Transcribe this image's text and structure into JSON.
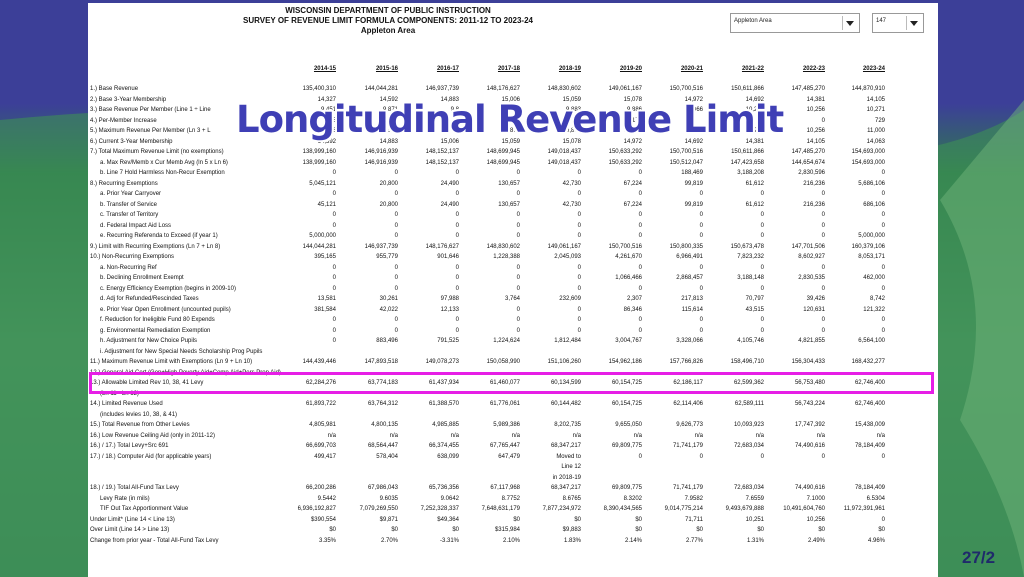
{
  "header": {
    "line1": "WISCONSIN DEPARTMENT OF PUBLIC INSTRUCTION",
    "line2": "SURVEY OF REVENUE LIMIT FORMULA COMPONENTS: 2011-12 TO 2023-24",
    "line3": "Appleton Area"
  },
  "controls": {
    "district_select": "Appleton Area",
    "code_select": "147"
  },
  "columns": [
    "2014-15",
    "2015-16",
    "2016-17",
    "2017-18",
    "2018-19",
    "2019-20",
    "2020-21",
    "2021-22",
    "2022-23",
    "2023-24"
  ],
  "rows": [
    {
      "label": "1.) Base Revenue",
      "values": [
        "135,400,310",
        "144,044,281",
        "146,937,739",
        "148,176,627",
        "148,830,602",
        "149,061,167",
        "150,700,516",
        "150,611,866",
        "147,485,270",
        "144,870,910"
      ]
    },
    {
      "label": "2.) Base 3-Year Membership",
      "values": [
        "14,327",
        "14,592",
        "14,883",
        "15,006",
        "15,059",
        "15,078",
        "14,972",
        "14,692",
        "14,381",
        "14,105"
      ]
    },
    {
      "label": "3.) Base Revenue Per Member (Line 1 ÷ Line",
      "values": [
        "9,451",
        "9,871",
        "9,8",
        "9,874",
        "9,883",
        "9,886",
        "10,066",
        "10,251",
        "10,256",
        "10,271"
      ]
    },
    {
      "label": "4.) Per-Member Increase",
      "values": [
        "75",
        "75",
        "",
        "",
        "",
        "175",
        "",
        "0",
        "0",
        "729"
      ]
    },
    {
      "label": "5.) Maximum Revenue Per Member (Ln 3 + L",
      "values": [
        "9,526",
        "9,946",
        "9,8",
        "9,874",
        "9,883",
        "10,061",
        "10,066",
        "10,251",
        "10,256",
        "11,000"
      ]
    },
    {
      "label": "6.) Current 3-Year Membership",
      "values": [
        "14,592",
        "14,883",
        "15,006",
        "15,059",
        "15,078",
        "14,972",
        "14,692",
        "14,381",
        "14,105",
        "14,063"
      ]
    },
    {
      "label": "7.) Total Maximum Revenue Limit (no exemptions)",
      "values": [
        "138,999,160",
        "146,916,939",
        "148,152,137",
        "148,699,945",
        "149,018,437",
        "150,633,292",
        "150,700,516",
        "150,611,866",
        "147,485,270",
        "154,693,000"
      ]
    },
    {
      "label": "a. Max Rev/Memb x Cur Memb Avg (ln 5 x Ln 6)",
      "ind": true,
      "values": [
        "138,999,160",
        "146,916,939",
        "148,152,137",
        "148,699,945",
        "149,018,437",
        "150,633,292",
        "150,512,047",
        "147,423,658",
        "144,654,674",
        "154,693,000"
      ]
    },
    {
      "label": "b. Line 7 Hold Harmless Non-Recur Exemption",
      "ind": true,
      "values": [
        "0",
        "0",
        "0",
        "0",
        "0",
        "0",
        "188,469",
        "3,188,208",
        "2,830,596",
        "0"
      ]
    },
    {
      "label": "8.) Recurring Exemptions",
      "values": [
        "5,045,121",
        "20,800",
        "24,490",
        "130,657",
        "42,730",
        "67,224",
        "99,819",
        "61,612",
        "216,236",
        "5,686,106"
      ]
    },
    {
      "label": "a. Prior Year Carryover",
      "ind": true,
      "values": [
        "0",
        "0",
        "0",
        "0",
        "0",
        "0",
        "0",
        "0",
        "0",
        "0"
      ]
    },
    {
      "label": "b. Transfer of Service",
      "ind": true,
      "values": [
        "45,121",
        "20,800",
        "24,490",
        "130,657",
        "42,730",
        "67,224",
        "99,819",
        "61,612",
        "216,236",
        "686,106"
      ]
    },
    {
      "label": "c. Transfer of Territory",
      "ind": true,
      "values": [
        "0",
        "0",
        "0",
        "0",
        "0",
        "0",
        "0",
        "0",
        "0",
        "0"
      ]
    },
    {
      "label": "d. Federal Impact Aid Loss",
      "ind": true,
      "values": [
        "0",
        "0",
        "0",
        "0",
        "0",
        "0",
        "0",
        "0",
        "0",
        "0"
      ]
    },
    {
      "label": "e. Recurring Referenda to Exceed (if year 1)",
      "ind": true,
      "values": [
        "5,000,000",
        "0",
        "0",
        "0",
        "0",
        "0",
        "0",
        "0",
        "0",
        "5,000,000"
      ]
    },
    {
      "label": "9.) Limit with Recurring Exemptions (Ln 7 + Ln 8)",
      "values": [
        "144,044,281",
        "146,937,739",
        "148,176,627",
        "148,830,602",
        "149,061,167",
        "150,700,516",
        "150,800,335",
        "150,673,478",
        "147,701,506",
        "160,379,106"
      ]
    },
    {
      "label": "10.) Non-Recurring Exemptions",
      "values": [
        "395,165",
        "955,779",
        "901,646",
        "1,228,388",
        "2,045,093",
        "4,261,670",
        "6,966,491",
        "7,823,232",
        "8,602,927",
        "8,053,171"
      ]
    },
    {
      "label": "a. Non-Recurring Ref",
      "ind": true,
      "values": [
        "0",
        "0",
        "0",
        "0",
        "0",
        "0",
        "0",
        "0",
        "0",
        "0"
      ]
    },
    {
      "label": "b. Declining Enrollment Exempt",
      "ind": true,
      "values": [
        "0",
        "0",
        "0",
        "0",
        "0",
        "1,066,466",
        "2,868,457",
        "3,188,148",
        "2,830,535",
        "462,000"
      ]
    },
    {
      "label": "c. Energy Efficiency Exemption (begins in 2009-10)",
      "ind": true,
      "values": [
        "0",
        "0",
        "0",
        "0",
        "0",
        "0",
        "0",
        "0",
        "0",
        "0"
      ]
    },
    {
      "label": "d. Adj for Refunded/Rescinded Taxes",
      "ind": true,
      "values": [
        "13,581",
        "30,261",
        "97,988",
        "3,764",
        "232,609",
        "2,307",
        "217,813",
        "70,797",
        "39,426",
        "8,742"
      ]
    },
    {
      "label": "e. Prior Year Open Enrollment (uncounted pupils)",
      "ind": true,
      "values": [
        "381,584",
        "42,022",
        "12,133",
        "0",
        "0",
        "86,346",
        "115,614",
        "43,515",
        "120,631",
        "121,322"
      ]
    },
    {
      "label": "f. Reduction for Ineligible Fund 80 Expends",
      "ind": true,
      "values": [
        "0",
        "0",
        "0",
        "0",
        "0",
        "0",
        "0",
        "0",
        "0",
        "0"
      ]
    },
    {
      "label": "g. Environmental Remediation Exemption",
      "ind": true,
      "values": [
        "0",
        "0",
        "0",
        "0",
        "0",
        "0",
        "0",
        "0",
        "0",
        "0"
      ]
    },
    {
      "label": "h. Adjustment for New Choice Pupils",
      "ind": true,
      "values": [
        "0",
        "883,496",
        "791,525",
        "1,224,624",
        "1,812,484",
        "3,004,767",
        "3,328,066",
        "4,105,746",
        "4,821,855",
        "6,564,100"
      ]
    },
    {
      "label": "i. Adjustment for New Special Needs Scholarship Prog Pupils",
      "ind": true,
      "values": [
        "",
        "",
        "",
        "",
        "",
        "",
        "",
        "",
        "",
        ""
      ]
    },
    {
      "label": "11.) Maximum Revenue Limit with Exemptions (Ln 9 + Ln 10)",
      "values": [
        "144,439,446",
        "147,893,518",
        "149,078,273",
        "150,058,990",
        "151,106,260",
        "154,962,186",
        "157,766,826",
        "158,496,710",
        "156,304,433",
        "168,432,277"
      ]
    },
    {
      "label": "12.) General Aid Cert (Gen+High Poverty Aid+Comp Aid+Pers Prop Aid)",
      "values": [
        "",
        "",
        "",
        "",
        "",
        "",
        "",
        "",
        "",
        ""
      ]
    },
    {
      "label": "13.) Allowable Limited Rev 10, 38, 41 Levy",
      "values": [
        "62,284,276",
        "63,774,183",
        "61,437,934",
        "61,460,077",
        "60,134,599",
        "60,154,725",
        "62,186,117",
        "62,599,362",
        "56,753,480",
        "62,746,400"
      ]
    },
    {
      "label": "(Ln 11 - Ln 12)",
      "ind": true,
      "values": [
        "",
        "",
        "",
        "",
        "",
        "",
        "",
        "",
        "",
        ""
      ]
    },
    {
      "label": "14.) Limited Revenue Used",
      "values": [
        "61,893,722",
        "63,764,312",
        "61,388,570",
        "61,776,061",
        "60,144,482",
        "60,154,725",
        "62,114,406",
        "62,589,111",
        "56,743,224",
        "62,746,400"
      ]
    },
    {
      "label": "(includes levies 10, 38, & 41)",
      "ind": true,
      "values": [
        "",
        "",
        "",
        "",
        "",
        "",
        "",
        "",
        "",
        ""
      ]
    },
    {
      "label": "15.) Total Revenue from Other Levies",
      "values": [
        "4,805,981",
        "4,800,135",
        "4,985,885",
        "5,989,386",
        "8,202,735",
        "9,655,050",
        "9,626,773",
        "10,093,923",
        "17,747,392",
        "15,438,009"
      ]
    },
    {
      "label": "16.) Low Revenue Ceiling Aid (only in 2011-12)",
      "values": [
        "n/a",
        "n/a",
        "n/a",
        "n/a",
        "n/a",
        "n/a",
        "n/a",
        "n/a",
        "n/a",
        "n/a"
      ]
    },
    {
      "label": "16.) / 17.) Total Levy+Src 691",
      "values": [
        "66,699,703",
        "68,564,447",
        "66,374,455",
        "67,765,447",
        "68,347,217",
        "69,809,775",
        "71,741,179",
        "72,683,034",
        "74,490,616",
        "78,184,409"
      ]
    },
    {
      "label": "17.) / 18.) Computer Aid (for applicable years)",
      "values": [
        "499,417",
        "578,404",
        "638,099",
        "647,479",
        "Moved to",
        "0",
        "0",
        "0",
        "0",
        "0"
      ]
    },
    {
      "label": "",
      "values": [
        "",
        "",
        "",
        "",
        "Line 12",
        "",
        "",
        "",
        "",
        ""
      ]
    },
    {
      "label": "",
      "values": [
        "",
        "",
        "",
        "",
        "in 2018-19",
        "",
        "",
        "",
        "",
        ""
      ]
    },
    {
      "label": "18.) / 19.) Total All-Fund Tax Levy",
      "values": [
        "66,200,286",
        "67,986,043",
        "65,736,356",
        "67,117,968",
        "68,347,217",
        "69,809,775",
        "71,741,179",
        "72,683,034",
        "74,490,616",
        "78,184,409"
      ]
    },
    {
      "label": "Levy Rate (in mils)",
      "ind": true,
      "values": [
        "9.5442",
        "9.6035",
        "9.0642",
        "8.7752",
        "8.6765",
        "8.3202",
        "7.9582",
        "7.6559",
        "7.1000",
        "6.5304"
      ]
    },
    {
      "label": "TIF Out Tax Apportionment Value",
      "ind": true,
      "values": [
        "6,936,192,827",
        "7,079,269,550",
        "7,252,328,337",
        "7,648,631,179",
        "7,877,234,972",
        "8,390,434,565",
        "9,014,775,214",
        "9,493,679,888",
        "10,491,604,760",
        "11,972,391,961"
      ]
    },
    {
      "label": "Under Limit* (Line 14 < Line 13)",
      "values": [
        "$390,554",
        "$9,871",
        "$49,364",
        "$0",
        "$0",
        "$0",
        "71,711",
        "10,251",
        "10,256",
        "0"
      ]
    },
    {
      "label": "Over Limit (Line 14 > Line 13)",
      "values": [
        "$0",
        "$0",
        "$0",
        "$315,984",
        "$9,883",
        "$0",
        "$0",
        "$0",
        "$0",
        "$0"
      ]
    },
    {
      "label": "Change from prior year - Total All-Fund Tax Levy",
      "values": [
        "3.35%",
        "2.70%",
        "-3.31%",
        "2.10%",
        "1.83%",
        "2.14%",
        "2.77%",
        "1.31%",
        "2.49%",
        "4.96%"
      ]
    }
  ],
  "overlay_title": "Longitudinal Revenue Limit",
  "page_number": "27/2"
}
